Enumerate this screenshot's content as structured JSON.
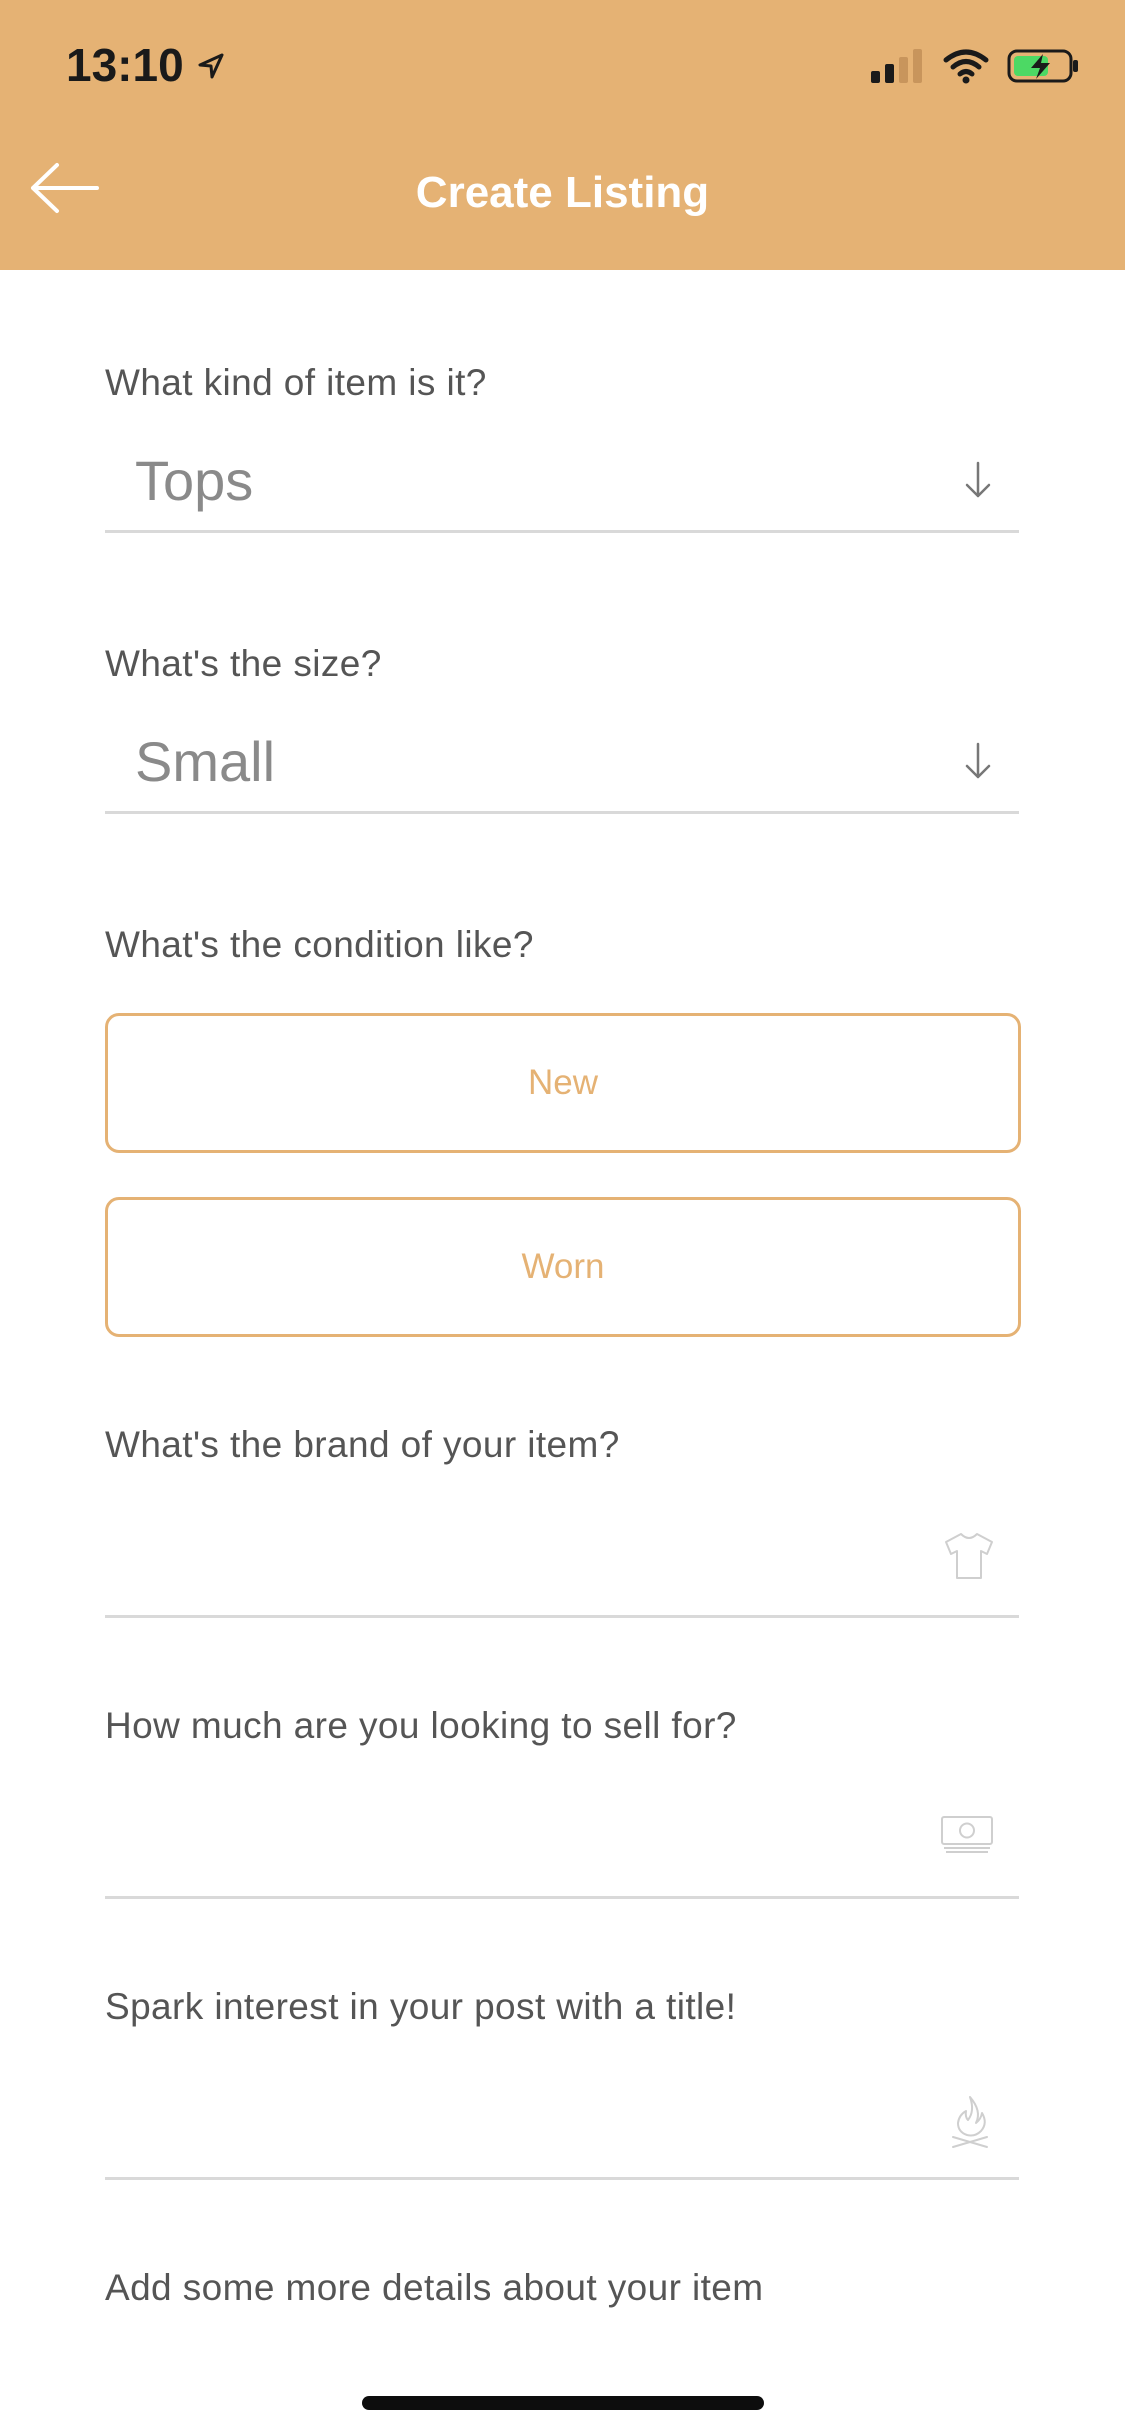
{
  "status_bar": {
    "time": "13:10",
    "icons": [
      "location-arrow-icon",
      "signal-icon",
      "wifi-icon",
      "battery-charging-icon"
    ]
  },
  "header": {
    "title": "Create Listing",
    "back_icon": "arrow-left-icon",
    "background_color": "#E5B274"
  },
  "form": {
    "item_kind": {
      "label": "What kind of item is it?",
      "value": "Tops",
      "icon": "arrow-down-icon"
    },
    "size": {
      "label": "What's the size?",
      "value": "Small",
      "icon": "arrow-down-icon"
    },
    "condition": {
      "label": "What's the condition like?",
      "options": [
        "New",
        "Worn"
      ]
    },
    "brand": {
      "label": "What's the brand of your item?",
      "value": "",
      "icon": "t-shirt-icon"
    },
    "price": {
      "label": "How much are you looking to sell for?",
      "value": "",
      "icon": "cash-icon"
    },
    "title": {
      "label": "Spark interest in your post with a title!",
      "value": "",
      "icon": "campfire-icon"
    },
    "details": {
      "label": "Add some more details about your item"
    }
  },
  "colors": {
    "accent": "#E5B274",
    "label_text": "#555555",
    "value_text": "#8a8a8a",
    "divider": "#d9d9d9"
  }
}
